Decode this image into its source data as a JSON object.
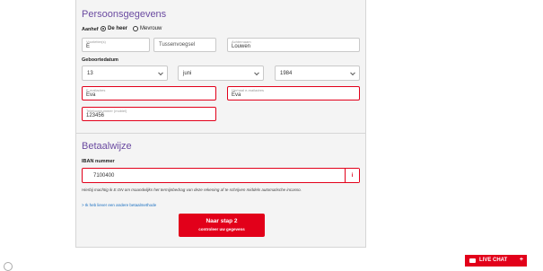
{
  "personal": {
    "title": "Persoonsgegevens",
    "salutation_label": "Aanhef",
    "option_mr": "De heer",
    "option_mrs": "Mevrouw",
    "initials_label": "Voorletter(s)",
    "initials_value": "E",
    "infix_placeholder": "Tussenvoegsel",
    "lastname_label": "Achternaam",
    "lastname_value": "Louwen",
    "birthdate_label": "Geboortedatum",
    "day": "13",
    "month": "juni",
    "year": "1984",
    "email_label": "E-mailadres",
    "email_value": "Eva",
    "email_confirm_label": "Herhaal e-mailadres",
    "email_confirm_value": "Eva",
    "phone_label": "Telefoonnummer (mobiel)",
    "phone_value": "123456"
  },
  "payment": {
    "title": "Betaalwijze",
    "iban_label": "IBAN nummer",
    "iban_value": "7100400",
    "info_icon": "i",
    "mandate_text": "Hierbij machtig ik E.ON om maandelijks het termijnbedrag van deze rekening af te schrijven middels automatische incasso.",
    "alt_method_link": "> Ik heb liever een andere betaalmethode"
  },
  "cta": {
    "line1": "Naar stap 2",
    "line2": "controleer uw gegevens"
  },
  "chat": {
    "label": "LIVE CHAT",
    "plus": "+"
  },
  "colors": {
    "accent": "#e2001a",
    "heading": "#6b4ba1",
    "link": "#1a6fc1"
  }
}
